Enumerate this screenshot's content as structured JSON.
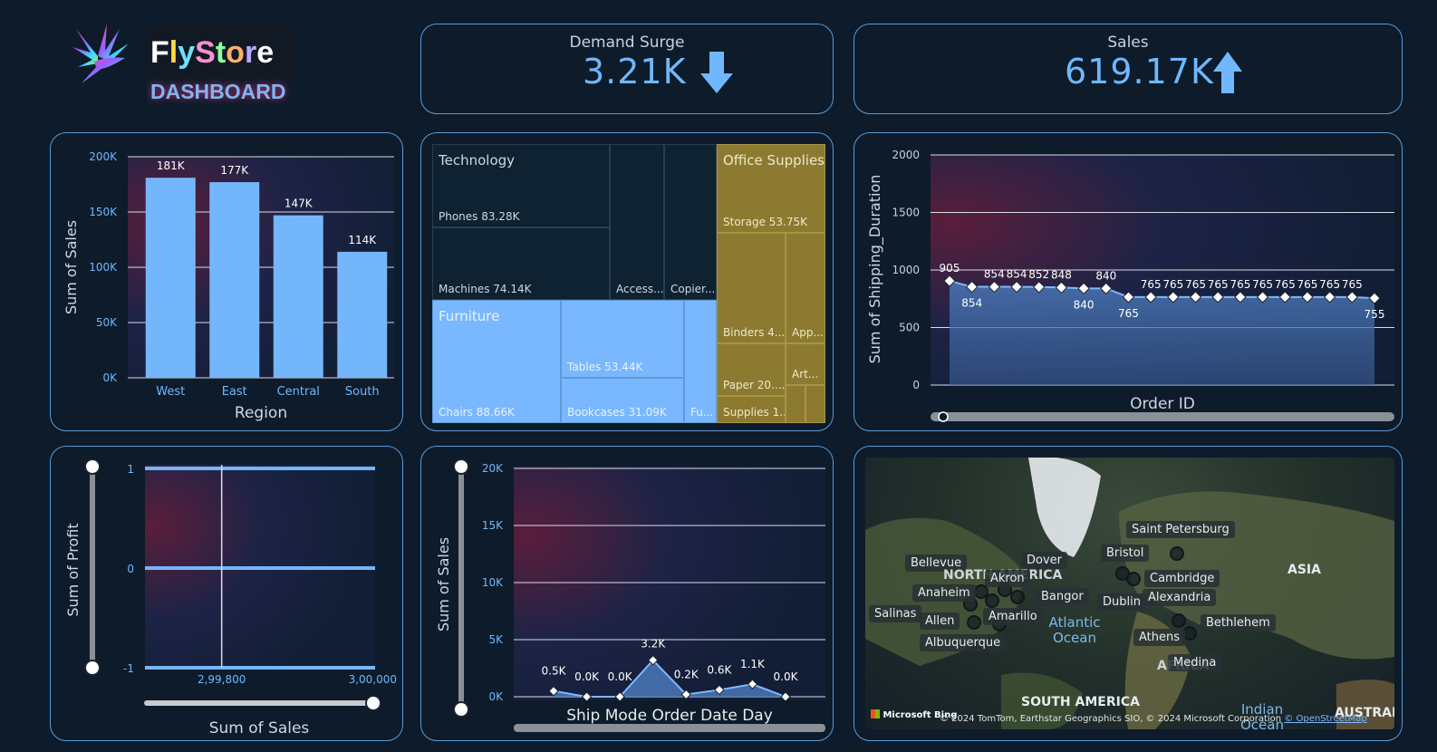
{
  "logo": {
    "title": "FlyStore",
    "subtitle": "DASHBOARD"
  },
  "kpis": {
    "demand_surge": {
      "label": "Demand Surge",
      "value": "3.21K",
      "trend": "down"
    },
    "sales": {
      "label": "Sales",
      "value": "619.17K",
      "trend": "up"
    }
  },
  "colors": {
    "accent": "#6fb8ff",
    "border": "#5a9bd8",
    "bg": "#0d1b2a",
    "office": "#8c7a30"
  },
  "region_chart": {
    "xlabel": "Region",
    "ylabel": "Sum of Sales",
    "ticks": [
      "0K",
      "50K",
      "100K",
      "150K",
      "200K"
    ]
  },
  "treemap": {
    "technology": {
      "label": "Technology",
      "phones": "Phones 83.28K",
      "machines": "Machines 74.14K",
      "access": "Access...",
      "copier": "Copier..."
    },
    "furniture": {
      "label": "Furniture",
      "chairs": "Chairs 88.66K",
      "tables": "Tables 53.44K",
      "bookcases": "Bookcases 31.09K",
      "fu": "Fu..."
    },
    "office": {
      "label": "Office Supplies",
      "storage": "Storage 53.75K",
      "binders": "Binders 4...",
      "app": "App...",
      "paper": "Paper 20....",
      "art": "Art...",
      "supplies": "Supplies 1..."
    }
  },
  "shipping_chart": {
    "xlabel": "Order ID",
    "ylabel": "Sum of Shipping_Duration",
    "ticks": [
      "0",
      "500",
      "1000",
      "1500",
      "2000"
    ]
  },
  "profit_chart": {
    "xlabel": "Sum of Sales",
    "ylabel": "Sum of Profit",
    "yticks": [
      "1",
      "0",
      "-1"
    ],
    "xticks": [
      "2,99,800",
      "3,00,000"
    ]
  },
  "shipmode_chart": {
    "xlabel": "Ship Mode Order Date Day",
    "ylabel": "Sum of Sales",
    "ticks": [
      "0K",
      "5K",
      "10K",
      "15K",
      "20K"
    ]
  },
  "map": {
    "cities": [
      "Saint Petersburg",
      "Bristol",
      "Dover",
      "Bellevue",
      "Cambridge",
      "Alexandria",
      "Anaheim",
      "Akron",
      "Bangor",
      "Dublin",
      "Salinas",
      "Allen",
      "Amarillo",
      "Bethlehem",
      "Athens",
      "Albuquerque",
      "Medina"
    ],
    "regions": [
      "NORTH AMERICA",
      "ASIA",
      "AFRICA",
      "SOUTH AMERICA",
      "AUSTRAL"
    ],
    "oceans": [
      "Atlantic Ocean",
      "Indian Ocean"
    ],
    "attribution": "© 2024 TomTom, Earthstar Geographics SIO, © 2024 Microsoft Corporation",
    "osm": "© OpenStreetMap",
    "brand": "Microsoft Bing"
  },
  "chart_data": [
    {
      "type": "bar",
      "categories": [
        "West",
        "East",
        "Central",
        "South"
      ],
      "values": [
        181000,
        177000,
        147000,
        114000
      ],
      "data_labels": [
        "181K",
        "177K",
        "147K",
        "114K"
      ],
      "xlabel": "Region",
      "ylabel": "Sum of Sales",
      "ylim": [
        0,
        200000
      ],
      "grid": true
    },
    {
      "type": "area",
      "values": [
        905,
        854,
        854,
        854,
        852,
        848,
        840,
        840,
        765,
        765,
        765,
        765,
        765,
        765,
        765,
        765,
        765,
        765,
        765,
        755
      ],
      "data_labels": [
        "905",
        "854",
        "854",
        "854",
        "852",
        "848",
        "840",
        "840",
        "765",
        "765",
        "765",
        "765",
        "765",
        "765",
        "765",
        "765",
        "765",
        "765",
        "765",
        "755"
      ],
      "xlabel": "Order ID",
      "ylabel": "Sum of Shipping_Duration",
      "ylim": [
        0,
        2000
      ],
      "grid": true
    },
    {
      "type": "scatter",
      "xlabel": "Sum of Sales",
      "ylabel": "Sum of Profit",
      "xlim": [
        299700,
        300000
      ],
      "ylim": [
        -1,
        1
      ],
      "y_lines": [
        1,
        0,
        -1
      ],
      "x_lines": [
        299800
      ]
    },
    {
      "type": "area",
      "values": [
        500,
        0,
        0,
        3200,
        200,
        600,
        1100,
        0
      ],
      "data_labels": [
        "0.5K",
        "0.0K",
        "0.0K",
        "3.2K",
        "0.2K",
        "0.6K",
        "1.1K",
        "0.0K"
      ],
      "xlabel": "Ship Mode Order Date Day",
      "ylabel": "Sum of Sales",
      "ylim": [
        0,
        20000
      ],
      "grid": true
    }
  ]
}
